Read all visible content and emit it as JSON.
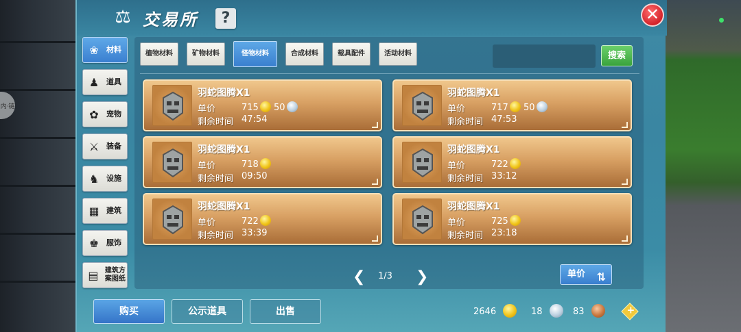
{
  "window": {
    "title": "交易所",
    "help_label": "?",
    "close_label": "✕"
  },
  "side_bubble_label": "内·链",
  "sidebar": {
    "items": [
      {
        "label": "材料",
        "icon": "materials-icon",
        "active": true
      },
      {
        "label": "道具",
        "icon": "items-icon",
        "active": false
      },
      {
        "label": "宠物",
        "icon": "pet-paw-icon",
        "active": false
      },
      {
        "label": "装备",
        "icon": "equipment-icon",
        "active": false
      },
      {
        "label": "设施",
        "icon": "facility-icon",
        "active": false
      },
      {
        "label": "建筑",
        "icon": "building-icon",
        "active": false
      },
      {
        "label": "服饰",
        "icon": "clothing-icon",
        "active": false
      },
      {
        "label": "建筑方案图纸",
        "icon": "blueprint-icon",
        "active": false
      }
    ]
  },
  "category_tabs": [
    {
      "label": "植物材料",
      "active": false
    },
    {
      "label": "矿物材料",
      "active": false
    },
    {
      "label": "怪物材料",
      "active": true
    },
    {
      "label": "合成材料",
      "active": false
    },
    {
      "label": "载具配件",
      "active": false
    },
    {
      "label": "活动材料",
      "active": false
    }
  ],
  "search": {
    "value": "",
    "button_label": "搜索"
  },
  "listing_labels": {
    "price": "单价",
    "time_left": "剩余时间"
  },
  "listings": [
    {
      "name": "羽蛇图腾X1",
      "price": "715",
      "silver": "50",
      "time_left": "47:54"
    },
    {
      "name": "羽蛇图腾X1",
      "price": "717",
      "silver": "50",
      "time_left": "47:53"
    },
    {
      "name": "羽蛇图腾X1",
      "price": "718",
      "silver": "",
      "time_left": "09:50"
    },
    {
      "name": "羽蛇图腾X1",
      "price": "722",
      "silver": "",
      "time_left": "33:12"
    },
    {
      "name": "羽蛇图腾X1",
      "price": "722",
      "silver": "",
      "time_left": "33:39"
    },
    {
      "name": "羽蛇图腾X1",
      "price": "725",
      "silver": "",
      "time_left": "23:18"
    }
  ],
  "pagination": {
    "prev": "❮",
    "next": "❯",
    "page": "1/3"
  },
  "sort_button_label": "单价",
  "bottom": {
    "buy_label": "购买",
    "public_items_label": "公示道具",
    "sell_label": "出售",
    "gold": "2646",
    "silver": "18",
    "copper": "83",
    "add_label": "+"
  },
  "colors": {
    "panel": "#3a86a2",
    "card": "#d8a063",
    "active_tab": "#3a7fcf",
    "search_button": "#3aa33c",
    "close_button": "#d4232b"
  }
}
